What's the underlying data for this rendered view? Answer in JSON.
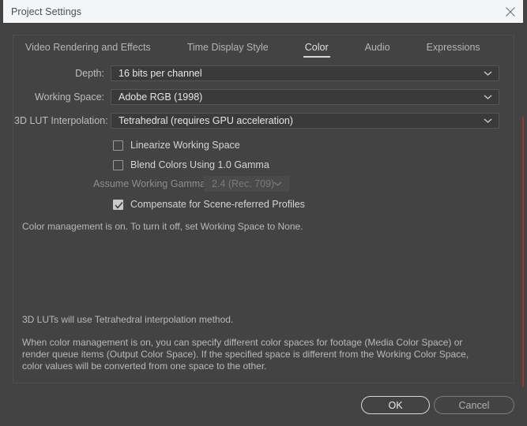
{
  "window": {
    "title": "Project Settings",
    "close_icon": "close-icon"
  },
  "tabs": [
    {
      "label": "Video Rendering and Effects",
      "active": false
    },
    {
      "label": "Time Display Style",
      "active": false
    },
    {
      "label": "Color",
      "active": true
    },
    {
      "label": "Audio",
      "active": false
    },
    {
      "label": "Expressions",
      "active": false
    }
  ],
  "fields": {
    "depth": {
      "label": "Depth:",
      "value": "16 bits per channel",
      "icon": "chevron-down-icon",
      "disabled": false
    },
    "working_space": {
      "label": "Working Space:",
      "value": "Adobe RGB (1998)",
      "icon": "chevron-down-icon",
      "disabled": false
    },
    "lut_interpolation": {
      "label": "3D LUT Interpolation:",
      "value": "Tetrahedral (requires GPU acceleration)",
      "icon": "chevron-down-icon",
      "disabled": false
    },
    "assume_working_gamma": {
      "label": "Assume Working Gamma:",
      "value": "2.4 (Rec. 709)",
      "icon": "chevron-down-icon",
      "disabled": true
    }
  },
  "checkboxes": {
    "linearize": {
      "label": "Linearize Working Space",
      "checked": false
    },
    "blend_gamma": {
      "label": "Blend Colors Using 1.0 Gamma",
      "checked": false
    },
    "compensate": {
      "label": "Compensate for Scene-referred Profiles",
      "checked": true
    }
  },
  "info": {
    "color_management": "Color management is on. To turn it off, set Working Space to None.",
    "lut_method": "3D LUTs will use Tetrahedral interpolation method.",
    "body": "When color management is on, you can specify different color spaces for footage (Media Color Space) or render queue items (Output Color Space). If the specified space is different from the Working Color Space, color values will be converted from one space to the other."
  },
  "footer": {
    "ok_label": "OK",
    "cancel_label": "Cancel"
  },
  "colors": {
    "dialog_bg": "#434343",
    "titlebar_bg": "#f4f5f6",
    "accent_red": "#8c3a38",
    "tab_underline": "#d6d6d6",
    "field_bg": "#3a3a3a"
  }
}
